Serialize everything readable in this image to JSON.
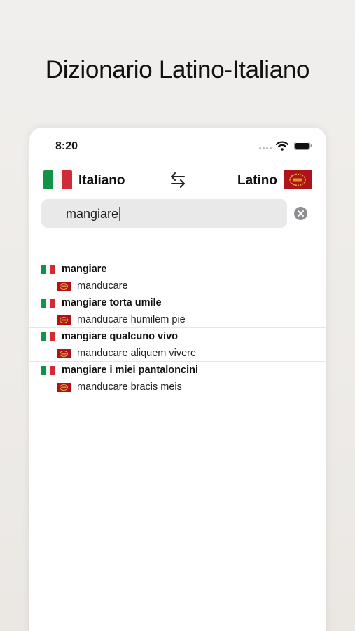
{
  "headline": "Dizionario Latino-Italiano",
  "status_bar": {
    "time": "8:20",
    "icons": [
      "signal-dots-icon",
      "wifi-icon",
      "battery-icon"
    ]
  },
  "language_bar": {
    "from_label": "Italiano",
    "from_flag": "italian-flag-icon",
    "swap_icon": "swap-arrows-icon",
    "to_label": "Latino",
    "to_flag": "spqr-flag-icon"
  },
  "search": {
    "value": "mangiare",
    "clear_icon": "clear-circle-icon"
  },
  "results": [
    {
      "italian": "mangiare",
      "latin": "manducare"
    },
    {
      "italian": "mangiare torta umile",
      "latin": "manducare humilem pie"
    },
    {
      "italian": "mangiare qualcuno vivo",
      "latin": "manducare aliquem vivere"
    },
    {
      "italian": "mangiare i miei pantaloncini",
      "latin": "manducare bracis meis"
    }
  ],
  "colors": {
    "italy_green": "#119447",
    "italy_white": "#f7f7f7",
    "italy_red": "#d02b37",
    "spqr_red": "#b0121a",
    "spqr_gold": "#e0b233",
    "caret_blue": "#1a73e8"
  }
}
